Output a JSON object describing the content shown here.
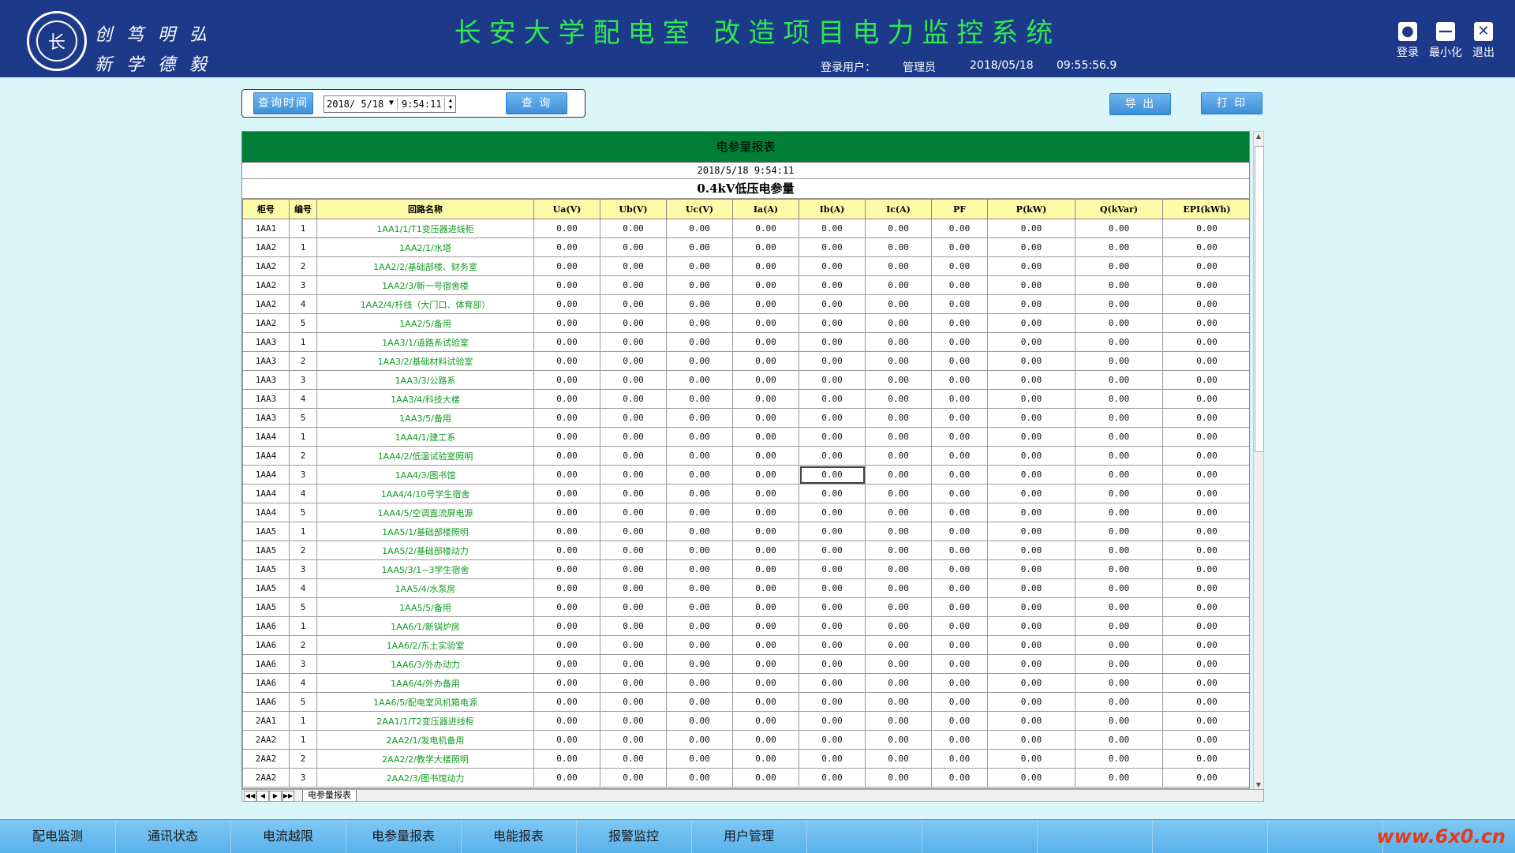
{
  "header": {
    "logo_glyph": "长",
    "motto": [
      "创",
      "笃",
      "明",
      "弘",
      "新",
      "学",
      "德",
      "毅"
    ],
    "title": "长安大学配电室 改造项目电力监控系统",
    "login_user_label": "登录用户：",
    "user": "管理员",
    "date": "2018/05/18",
    "time": "09:55:56.9",
    "buttons": {
      "login": "登录",
      "minimize": "最小化",
      "exit": "退出"
    }
  },
  "query": {
    "time_label": "查询时间",
    "date_value": "2018/ 5/18",
    "time_value": "9:54:11",
    "query_button": "查 询",
    "export_button": "导 出",
    "print_button": "打 印"
  },
  "report": {
    "title": "电参量报表",
    "timestamp": "2018/5/18 9:54:11",
    "subtitle": "0.4kV低压电参量",
    "columns": [
      "柜号",
      "编号",
      "回路名称",
      "Ua(V)",
      "Ub(V)",
      "Uc(V)",
      "Ia(A)",
      "Ib(A)",
      "Ic(A)",
      "PF",
      "P(kW)",
      "Q(kVar)",
      "EPI(kWh)"
    ],
    "rows": [
      [
        "1AA1",
        "1",
        "1AA1/1/T1变压器进线柜"
      ],
      [
        "1AA2",
        "1",
        "1AA2/1/水塔"
      ],
      [
        "1AA2",
        "2",
        "1AA2/2/基础部楼、财务室"
      ],
      [
        "1AA2",
        "3",
        "1AA2/3/新一号宿舍楼"
      ],
      [
        "1AA2",
        "4",
        "1AA2/4/杆线（大门口、体育部）"
      ],
      [
        "1AA2",
        "5",
        "1AA2/5/备用"
      ],
      [
        "1AA3",
        "1",
        "1AA3/1/道路系试验室"
      ],
      [
        "1AA3",
        "2",
        "1AA3/2/基础材料试验室"
      ],
      [
        "1AA3",
        "3",
        "1AA3/3/公路系"
      ],
      [
        "1AA3",
        "4",
        "1AA3/4/科技大楼"
      ],
      [
        "1AA3",
        "5",
        "1AA3/5/备用"
      ],
      [
        "1AA4",
        "1",
        "1AA4/1/建工系"
      ],
      [
        "1AA4",
        "2",
        "1AA4/2/低温试验室照明"
      ],
      [
        "1AA4",
        "3",
        "1AA4/3/图书馆"
      ],
      [
        "1AA4",
        "4",
        "1AA4/4/10号学生宿舍"
      ],
      [
        "1AA4",
        "5",
        "1AA4/5/空调直流屏电源"
      ],
      [
        "1AA5",
        "1",
        "1AA5/1/基础部楼照明"
      ],
      [
        "1AA5",
        "2",
        "1AA5/2/基础部楼动力"
      ],
      [
        "1AA5",
        "3",
        "1AA5/3/1~3学生宿舍"
      ],
      [
        "1AA5",
        "4",
        "1AA5/4/水泵房"
      ],
      [
        "1AA5",
        "5",
        "1AA5/5/备用"
      ],
      [
        "1AA6",
        "1",
        "1AA6/1/新锅炉房"
      ],
      [
        "1AA6",
        "2",
        "1AA6/2/东土实验室"
      ],
      [
        "1AA6",
        "3",
        "1AA6/3/外办动力"
      ],
      [
        "1AA6",
        "4",
        "1AA6/4/外办备用"
      ],
      [
        "1AA6",
        "5",
        "1AA6/5/配电室风机箱电源"
      ],
      [
        "2AA1",
        "1",
        "2AA1/1/T2变压器进线柜"
      ],
      [
        "2AA2",
        "1",
        "2AA2/1/发电机备用"
      ],
      [
        "2AA2",
        "2",
        "2AA2/2/教学大楼照明"
      ],
      [
        "2AA2",
        "3",
        "2AA2/3/图书馆动力"
      ]
    ],
    "value": "0.00",
    "sheet_tab": "电参量报表"
  },
  "nav": [
    "配电监测",
    "通讯状态",
    "电流越限",
    "电参量报表",
    "电能报表",
    "报警监控",
    "用户管理"
  ],
  "watermark": "www.6x0.cn",
  "colors": {
    "header_bg": "#1d3a8a",
    "title": "#2ee84e",
    "table_header": "#fdfba8",
    "report_title_bg": "#007e35",
    "circuit_text": "#119b22"
  }
}
